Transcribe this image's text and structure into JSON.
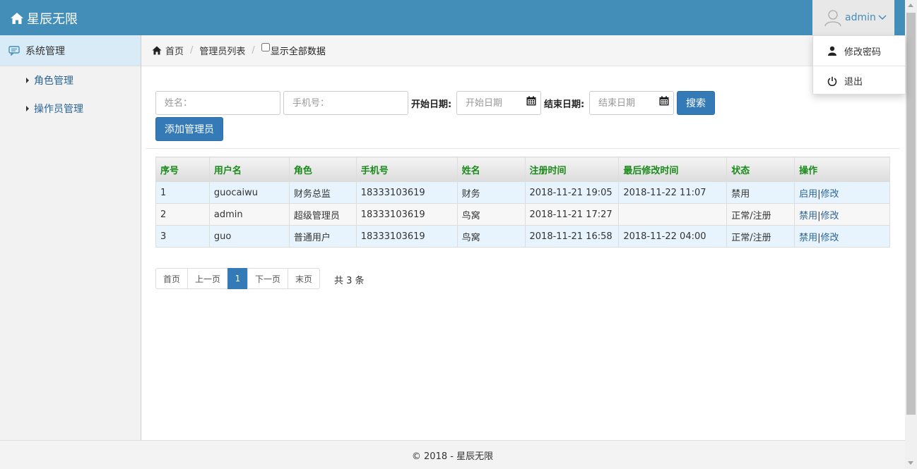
{
  "app": {
    "title": "星辰无限"
  },
  "user": {
    "name": "admin"
  },
  "user_menu": {
    "items": [
      "修改密码",
      "退出"
    ]
  },
  "sidebar": {
    "section": "系统管理",
    "items": [
      "角色管理",
      "操作员管理"
    ]
  },
  "breadcrumb": {
    "home": "首页",
    "current": "管理员列表",
    "show_all": "显示全部数据"
  },
  "filters": {
    "name_placeholder": "姓名：",
    "phone_placeholder": "手机号：",
    "start_label": "开始日期:",
    "start_placeholder": "开始日期",
    "end_label": "结束日期:",
    "end_placeholder": "结束日期",
    "search_button": "搜索",
    "add_button": "添加管理员"
  },
  "table": {
    "columns": [
      "序号",
      "用户名",
      "角色",
      "手机号",
      "姓名",
      "注册时间",
      "最后修改时间",
      "状态",
      "操作"
    ],
    "rows": [
      {
        "no": "1",
        "username": "guocaiwu",
        "role": "财务总监",
        "phone": "18333103619",
        "name": "财务",
        "created": "2018-11-21 19:05",
        "modified": "2018-11-22 11:07",
        "status": "禁用",
        "action1": "启用",
        "action2": "修改"
      },
      {
        "no": "2",
        "username": "admin",
        "role": "超级管理员",
        "phone": "18333103619",
        "name": "鸟窝",
        "created": "2018-11-21 17:27",
        "modified": "",
        "status": "正常/注册",
        "action1": "禁用",
        "action2": "修改"
      },
      {
        "no": "3",
        "username": "guo",
        "role": "普通用户",
        "phone": "18333103619",
        "name": "鸟窝",
        "created": "2018-11-21 16:58",
        "modified": "2018-11-22 04:00",
        "status": "正常/注册",
        "action1": "禁用",
        "action2": "修改"
      }
    ]
  },
  "pagination": {
    "first": "首页",
    "prev": "上一页",
    "current": "1",
    "next": "下一页",
    "last": "末页",
    "total": "共 3 条"
  },
  "footer": {
    "text": "© 2018 - 星辰无限"
  },
  "colors": {
    "header": "#438eb9",
    "primary": "#337ab7",
    "column_header_text": "#1a8a1a"
  }
}
